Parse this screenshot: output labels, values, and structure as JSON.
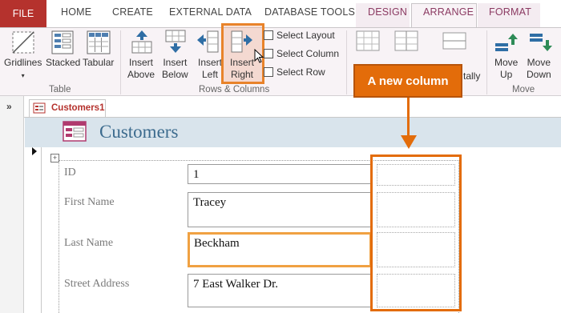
{
  "ribbon": {
    "tabs": [
      {
        "label": "FILE"
      },
      {
        "label": "HOME"
      },
      {
        "label": "CREATE"
      },
      {
        "label": "EXTERNAL DATA"
      },
      {
        "label": "DATABASE TOOLS"
      },
      {
        "label": "DESIGN"
      },
      {
        "label": "ARRANGE"
      },
      {
        "label": "FORMAT"
      }
    ],
    "active_tab": "ARRANGE",
    "groups": {
      "table": {
        "label": "Table",
        "buttons": [
          {
            "label": "Gridlines",
            "icon": "gridlines-icon"
          },
          {
            "label": "Stacked",
            "icon": "stacked-icon"
          },
          {
            "label": "Tabular",
            "icon": "tabular-icon"
          }
        ]
      },
      "rows_columns": {
        "label": "Rows & Columns",
        "buttons": [
          {
            "line1": "Insert",
            "line2": "Above",
            "icon": "insert-above-icon"
          },
          {
            "line1": "Insert",
            "line2": "Below",
            "icon": "insert-below-icon"
          },
          {
            "line1": "Insert",
            "line2": "Left",
            "icon": "insert-left-icon"
          },
          {
            "line1": "Insert",
            "line2": "Right",
            "icon": "insert-right-icon"
          }
        ],
        "small_buttons": [
          {
            "label": "Select Layout",
            "icon": "select-layout-icon"
          },
          {
            "label": "Select Column",
            "icon": "select-column-icon"
          },
          {
            "label": "Select Row",
            "icon": "select-row-icon"
          }
        ]
      },
      "merge": {
        "partial_label": "tally"
      },
      "move": {
        "label": "Move",
        "buttons": [
          {
            "line1": "Move",
            "line2": "Up",
            "icon": "move-up-icon"
          },
          {
            "line1": "Move",
            "line2": "Down",
            "icon": "move-down-icon"
          }
        ]
      }
    }
  },
  "document": {
    "tab_label": "Customers1",
    "form_title": "Customers",
    "fields": [
      {
        "label": "ID",
        "value": "1"
      },
      {
        "label": "First Name",
        "value": "Tracey"
      },
      {
        "label": "Last Name",
        "value": "Beckham"
      },
      {
        "label": "Street Address",
        "value": "7 East Walker Dr."
      }
    ]
  },
  "callout": {
    "text": "A new column"
  },
  "colors": {
    "file_tab": "#b5322d",
    "accent_orange": "#e36c0a",
    "form_header": "#d9e4ec",
    "form_title": "#3c6b8e"
  }
}
